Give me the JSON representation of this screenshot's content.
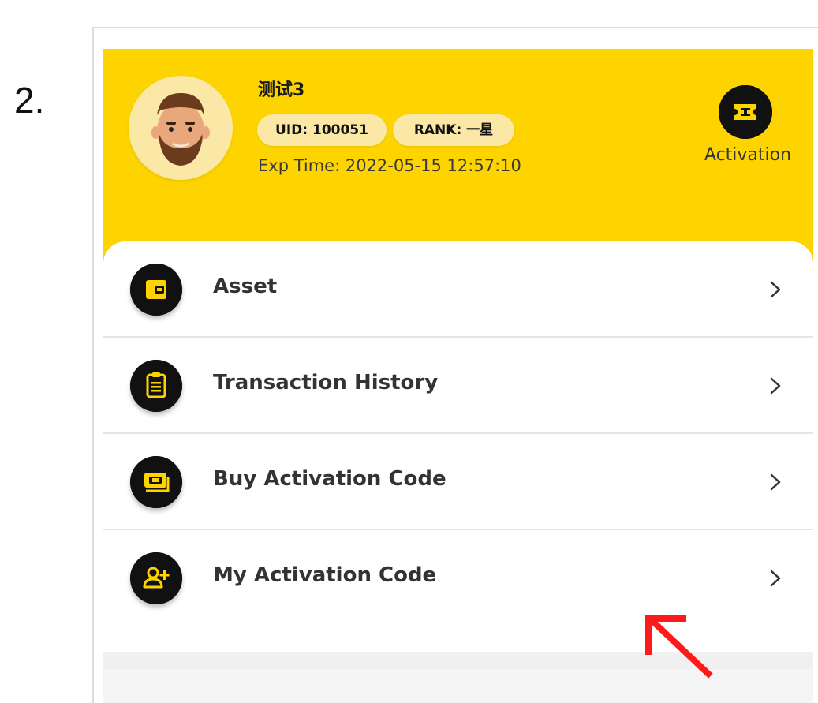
{
  "step": {
    "number": "2."
  },
  "profile": {
    "username": "测试3",
    "uid_badge": "UID: 100051",
    "rank_badge": "RANK: 一星",
    "exp_time": "Exp Time: 2022-05-15 12:57:10"
  },
  "activation": {
    "label": "Activation",
    "icon": "ticket-icon"
  },
  "menu": {
    "items": [
      {
        "label": "Asset",
        "icon": "wallet-icon"
      },
      {
        "label": "Transaction History",
        "icon": "clipboard-icon"
      },
      {
        "label": "Buy Activation Code",
        "icon": "cash-icon"
      },
      {
        "label": "My Activation Code",
        "icon": "user-plus-icon"
      }
    ]
  },
  "colors": {
    "header_yellow": "#fdd400",
    "badge_bg": "#fbe8a6",
    "icon_black": "#111111",
    "accent_yellow": "#fdd400",
    "annotation_red": "#ff1a1a"
  }
}
